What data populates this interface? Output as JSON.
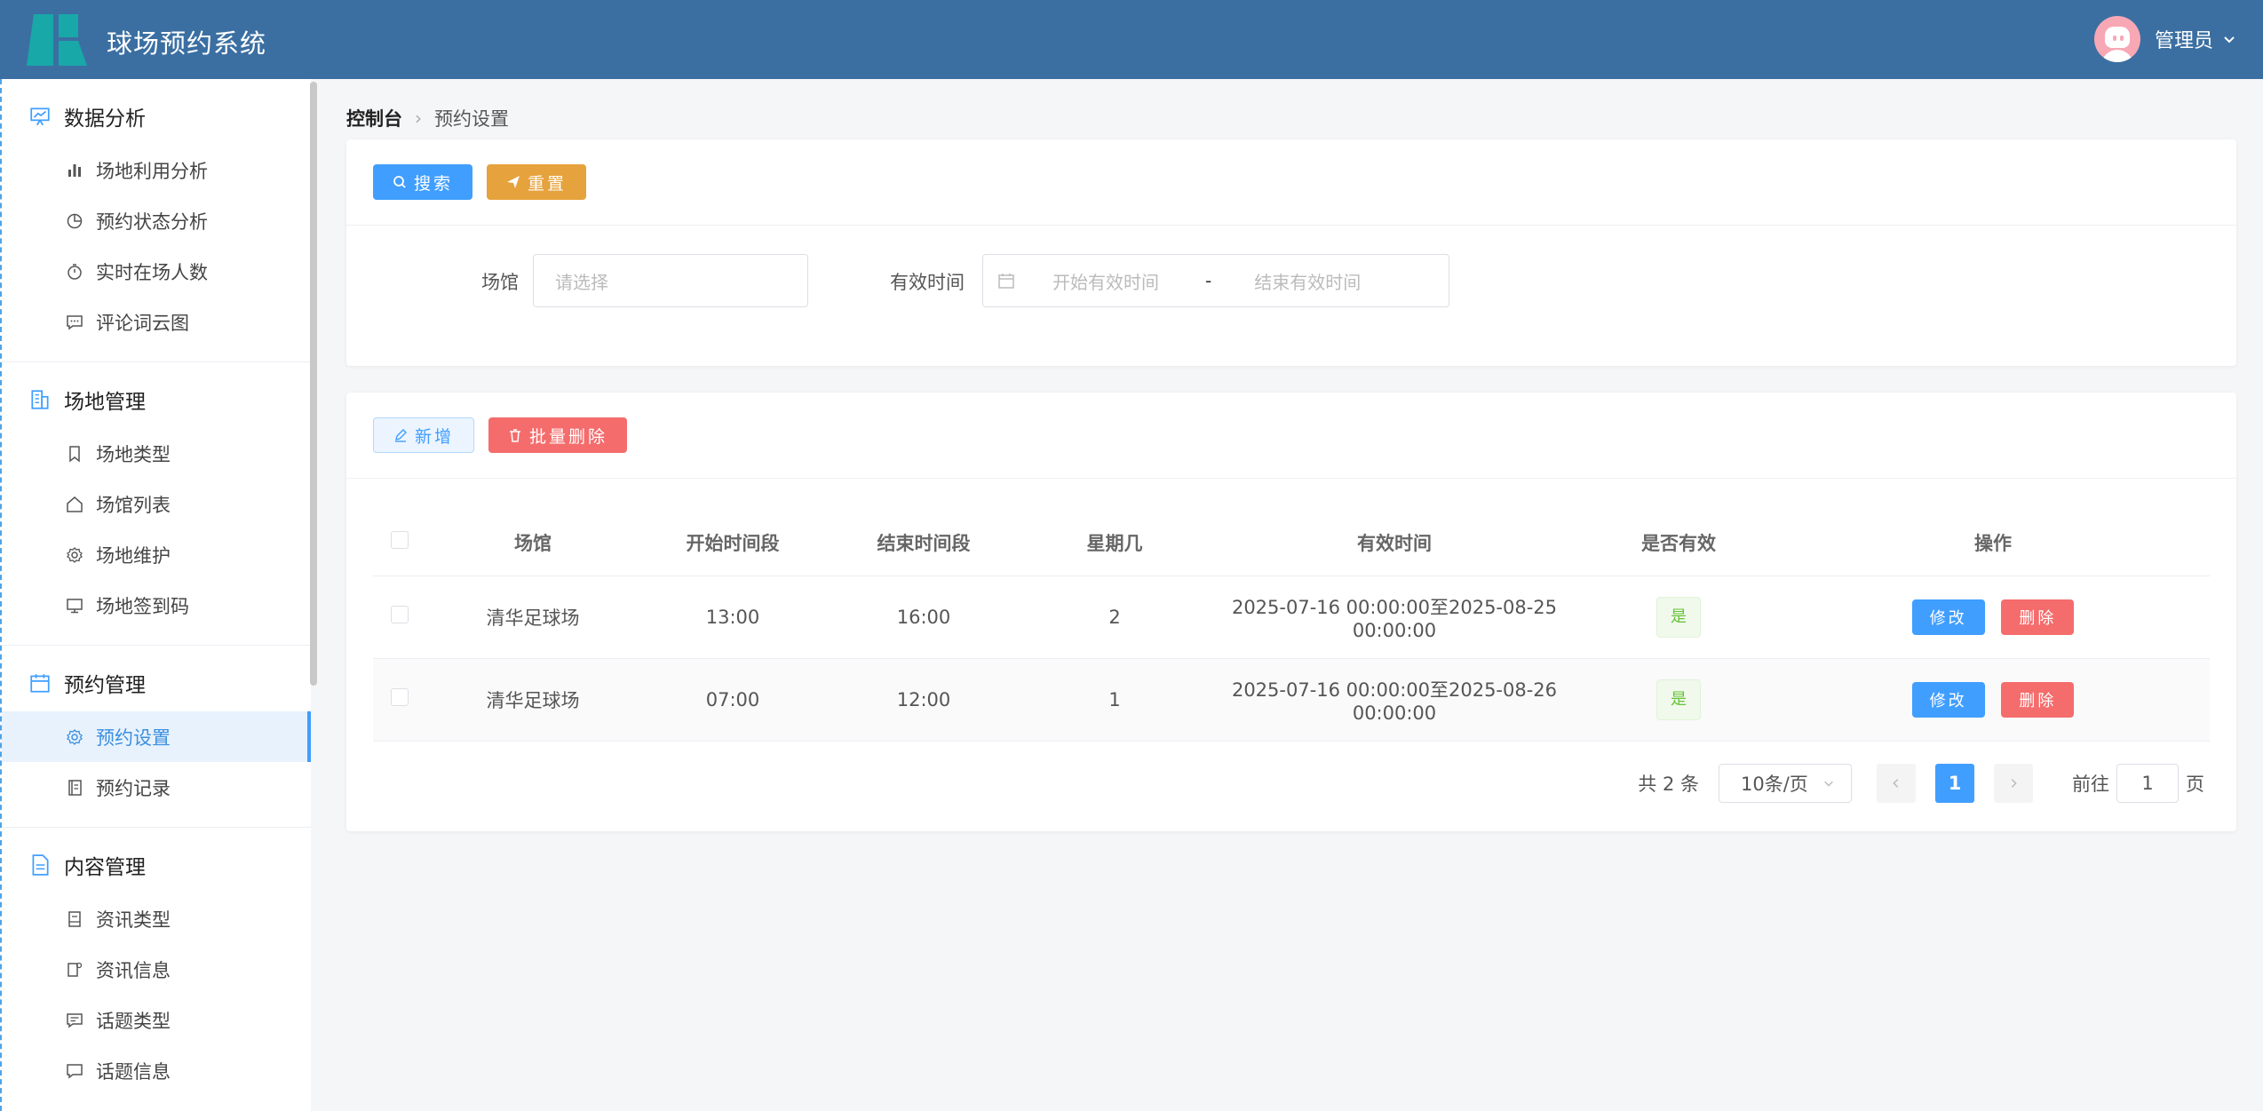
{
  "header": {
    "title": "球场预约系统",
    "user": "管理员"
  },
  "sidebar": {
    "groups": [
      {
        "title": "数据分析",
        "items": [
          "场地利用分析",
          "预约状态分析",
          "实时在场人数",
          "评论词云图"
        ]
      },
      {
        "title": "场地管理",
        "items": [
          "场地类型",
          "场馆列表",
          "场地维护",
          "场地签到码"
        ]
      },
      {
        "title": "预约管理",
        "items": [
          "预约设置",
          "预约记录"
        ]
      },
      {
        "title": "内容管理",
        "items": [
          "资讯类型",
          "资讯信息",
          "话题类型",
          "话题信息"
        ]
      }
    ],
    "active": "预约设置"
  },
  "breadcrumb": {
    "home": "控制台",
    "current": "预约设置"
  },
  "search": {
    "search_btn": "搜索",
    "reset_btn": "重置",
    "venue_label": "场馆",
    "venue_placeholder": "请选择",
    "time_label": "有效时间",
    "start_placeholder": "开始有效时间",
    "range_sep": "-",
    "end_placeholder": "结束有效时间"
  },
  "toolbar": {
    "add_btn": "新增",
    "batch_delete_btn": "批量删除"
  },
  "table": {
    "columns": [
      "场馆",
      "开始时间段",
      "结束时间段",
      "星期几",
      "有效时间",
      "是否有效",
      "操作"
    ],
    "rows": [
      {
        "venue": "清华足球场",
        "start": "13:00",
        "end": "16:00",
        "weekday": "2",
        "valid_time": "2025-07-16 00:00:00至2025-08-25 00:00:00",
        "is_valid": "是"
      },
      {
        "venue": "清华足球场",
        "start": "07:00",
        "end": "12:00",
        "weekday": "1",
        "valid_time": "2025-07-16 00:00:00至2025-08-26 00:00:00",
        "is_valid": "是"
      }
    ],
    "edit_btn": "修改",
    "delete_btn": "删除"
  },
  "pagination": {
    "total": "共 2 条",
    "page_size": "10条/页",
    "current_page": "1",
    "goto_prefix": "前往",
    "goto_value": "1",
    "goto_suffix": "页"
  },
  "colors": {
    "header": "#3b6fa2",
    "primary": "#409eff",
    "warning": "#e6a23c",
    "danger": "#f56c6c",
    "success": "#67c23a"
  }
}
